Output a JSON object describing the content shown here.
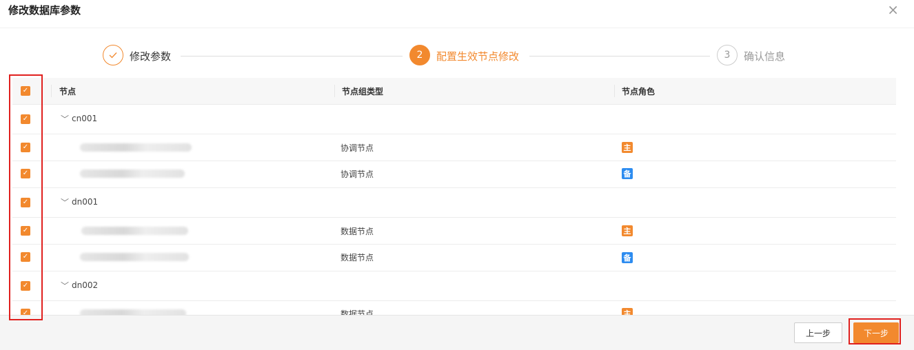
{
  "dialog": {
    "title": "修改数据库参数"
  },
  "steps": [
    {
      "label": "修改参数",
      "state": "done"
    },
    {
      "number": "2",
      "label": "配置生效节点修改",
      "state": "active"
    },
    {
      "number": "3",
      "label": "确认信息",
      "state": "wait"
    }
  ],
  "table": {
    "columns": [
      "节点",
      "节点组类型",
      "节点角色"
    ],
    "groups": [
      {
        "name": "cn001",
        "nodes": [
          {
            "type": "协调节点",
            "role": "主"
          },
          {
            "type": "协调节点",
            "role": "备"
          }
        ]
      },
      {
        "name": "dn001",
        "nodes": [
          {
            "type": "数据节点",
            "role": "主"
          },
          {
            "type": "数据节点",
            "role": "备"
          }
        ]
      },
      {
        "name": "dn002",
        "nodes": [
          {
            "type": "数据节点",
            "role": "主"
          }
        ]
      }
    ]
  },
  "footer": {
    "prev_label": "上一步",
    "next_label": "下一步"
  },
  "colors": {
    "accent": "#f2892e",
    "backup_badge": "#2d8cf0",
    "highlight": "#e0201e"
  },
  "icons": {
    "close": "close-icon",
    "check": "checkmark-icon",
    "expand": "chevron-down-icon"
  }
}
